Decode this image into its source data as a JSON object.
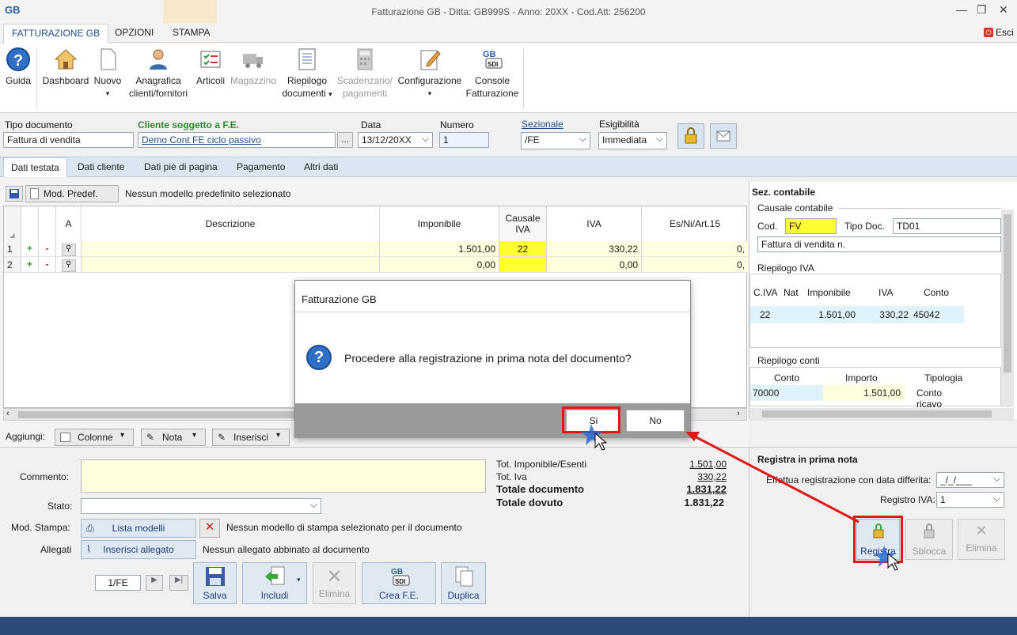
{
  "window": {
    "title": "Fatturazione GB - Ditta: GB999S - Anno: 20XX - Cod.Att: 256200",
    "logo": "GB",
    "exit_label": "Esci"
  },
  "ribbon_tabs": [
    "FATTURAZIONE GB",
    "OPZIONI",
    "STAMPA"
  ],
  "ribbon": {
    "guida": "Guida",
    "dashboard": "Dashboard",
    "nuovo": "Nuovo",
    "anagrafica_1": "Anagrafica",
    "anagrafica_2": "clienti/fornitori",
    "articoli": "Articoli",
    "magazzino": "Magazzino",
    "riepilogo_1": "Riepilogo",
    "riepilogo_2": "documenti",
    "scadenzario_1": "Scadenzario/",
    "scadenzario_2": "pagamenti",
    "configurazione": "Configurazione",
    "console_1": "Console",
    "console_2": "Fatturazione",
    "console_badge": "SDI"
  },
  "header": {
    "tipo_label": "Tipo documento",
    "tipo_value": "Fattura di vendita",
    "cliente_label": "Cliente soggetto a F.E.",
    "cliente_value": "Demo Cont FE ciclo passivo",
    "ellipsis": "...",
    "data_label": "Data",
    "data_value": "13/12/20XX",
    "numero_label": "Numero",
    "numero_value": "1",
    "sezionale_label": "Sezionale",
    "sezionale_value": "/FE",
    "esigibilita_label": "Esigibilità",
    "esigibilita_value": "Immediata"
  },
  "doc_tabs": [
    "Dati testata",
    "Dati cliente",
    "Dati piè di pagina",
    "Pagamento",
    "Altri dati"
  ],
  "model_bar": {
    "button": "Mod. Predef.",
    "text": "Nessun modello predefinito selezionato"
  },
  "grid": {
    "headers": {
      "a": "A",
      "descrizione": "Descrizione",
      "imponibile": "Imponibile",
      "causale_1": "Causale",
      "causale_2": "IVA",
      "iva": "IVA",
      "esni": "Es/Ni/Art.15"
    },
    "rows": [
      {
        "n": "1",
        "imponibile": "1.501,00",
        "causale": "22",
        "iva": "330,22",
        "esni": "0,"
      },
      {
        "n": "2",
        "imponibile": "0,00",
        "causale": "",
        "iva": "0,00",
        "esni": "0,"
      }
    ],
    "plus": "+",
    "minus": "-"
  },
  "add_bar": {
    "label": "Aggiungi:",
    "colonne": "Colonne",
    "nota": "Nota",
    "inserisci": "Inserisci"
  },
  "sez_contabile": {
    "title": "Sez. contabile",
    "causale_title": "Causale contabile",
    "cod_label": "Cod.",
    "cod_value": "FV",
    "tipo_label": "Tipo Doc.",
    "tipo_value": "TD01",
    "desc_value": "Fattura di vendita n.",
    "riep_iva_title": "Riepilogo IVA",
    "riep_iva_headers": [
      "C.IVA",
      "Nat",
      "Imponibile",
      "IVA",
      "Conto"
    ],
    "riep_iva_row": [
      "22",
      "",
      "1.501,00",
      "330,22",
      "45042"
    ],
    "riep_conti_title": "Riepilogo conti",
    "riep_conti_headers": [
      "Conto",
      "Importo",
      "Tipologia"
    ],
    "riep_conti_row": [
      "70000",
      "1.501,00",
      "Conto ricavo"
    ]
  },
  "dialog": {
    "title": "Fatturazione GB",
    "message": "Procedere alla registrazione in prima nota del documento?",
    "yes": "Si",
    "no": "No"
  },
  "footer": {
    "commento_label": "Commento:",
    "stato_label": "Stato:",
    "mod_stampa_label": "Mod. Stampa:",
    "lista_modelli": "Lista modelli",
    "mod_stampa_text": "Nessun modello di stampa selezionato per il documento",
    "allegati_label": "Allegati",
    "inserisci_allegato": "Inserisci allegato",
    "allegati_text": "Nessun allegato abbinato al documento",
    "pager": "1/FE",
    "salva": "Salva",
    "includi": "Includi",
    "elimina": "Elimina",
    "crea_fe": "Crea F.E.",
    "duplica": "Duplica",
    "sdi": "SDI"
  },
  "totals": {
    "imponibile_label": "Tot. Imponibile/Esenti",
    "imponibile_value": "1.501,00",
    "iva_label": "Tot. Iva",
    "iva_value": "330,22",
    "documento_label": "Totale documento",
    "documento_value": "1.831,22",
    "dovuto_label": "Totale dovuto",
    "dovuto_value": "1.831,22"
  },
  "prima_nota": {
    "title": "Registra in prima nota",
    "differita_label": "Effettua registrazione con data differita:",
    "differita_value": "_/_/___",
    "registro_label": "Registro IVA:",
    "registro_value": "1",
    "registra": "Registra",
    "sblocca": "Sblocca",
    "elimina": "Elimina"
  },
  "colors": {
    "accent": "#1f4e8c",
    "highlight_red": "#e01818",
    "yellow": "#ffff33",
    "status_bar": "#2c4a78"
  }
}
